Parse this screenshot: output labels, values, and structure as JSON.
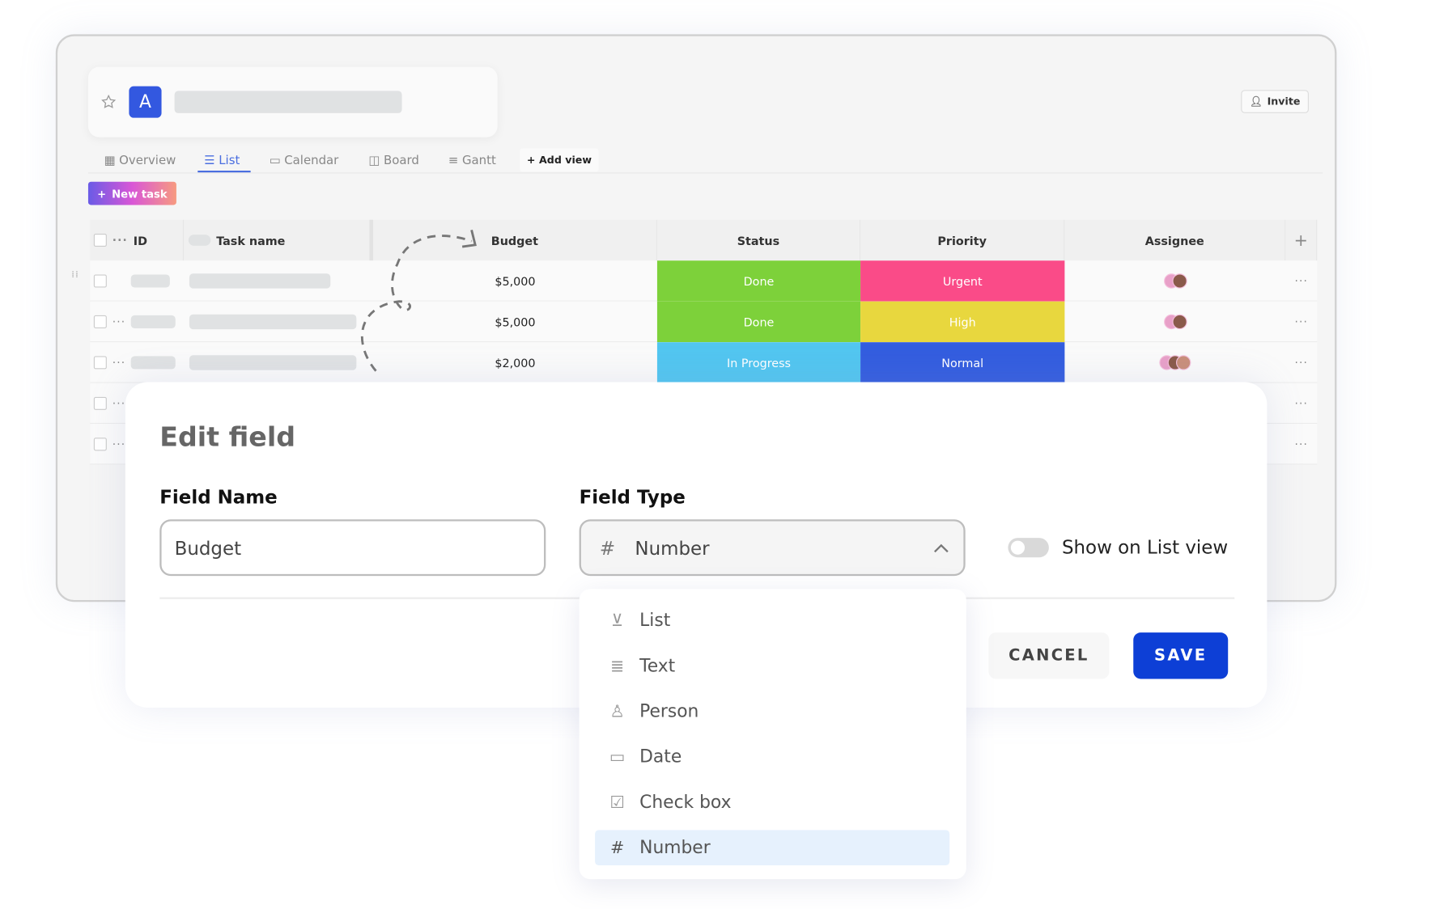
{
  "header": {
    "badge_letter": "A",
    "invite_label": "Invite"
  },
  "tabs": [
    {
      "label": "Overview"
    },
    {
      "label": "List",
      "active": true
    },
    {
      "label": "Calendar"
    },
    {
      "label": "Board"
    },
    {
      "label": "Gantt"
    }
  ],
  "add_view_label": "Add view",
  "new_task_label": "New task",
  "table": {
    "columns": [
      "ID",
      "Task name",
      "Budget",
      "Status",
      "Priority",
      "Assignee"
    ],
    "rows": [
      {
        "budget": "$5,000",
        "status": "Done",
        "status_color": "#7dd13a",
        "priority": "Urgent",
        "priority_color": "#fa4b88",
        "assignees": 2
      },
      {
        "budget": "$5,000",
        "status": "Done",
        "status_color": "#7dd13a",
        "priority": "High",
        "priority_color": "#e8d73e",
        "assignees": 2
      },
      {
        "budget": "$2,000",
        "status": "In Progress",
        "status_color": "#52c6f0",
        "priority": "Normal",
        "priority_color": "#335ddf",
        "assignees": 3
      }
    ]
  },
  "modal": {
    "title": "Edit field",
    "field_name_label": "Field Name",
    "field_name_value": "Budget",
    "field_type_label": "Field Type",
    "field_type_value": "Number",
    "toggle_label": "Show on List view",
    "toggle_on": false,
    "cancel_label": "CANCEL",
    "save_label": "SAVE",
    "save_color": "#0d3fd6"
  },
  "dropdown": {
    "items": [
      {
        "label": "List",
        "icon": "list-select-icon"
      },
      {
        "label": "Text",
        "icon": "text-lines-icon"
      },
      {
        "label": "Person",
        "icon": "person-icon"
      },
      {
        "label": "Date",
        "icon": "calendar-icon"
      },
      {
        "label": "Check box",
        "icon": "checkbox-icon"
      },
      {
        "label": "Number",
        "icon": "hash-icon",
        "selected": true
      }
    ]
  }
}
